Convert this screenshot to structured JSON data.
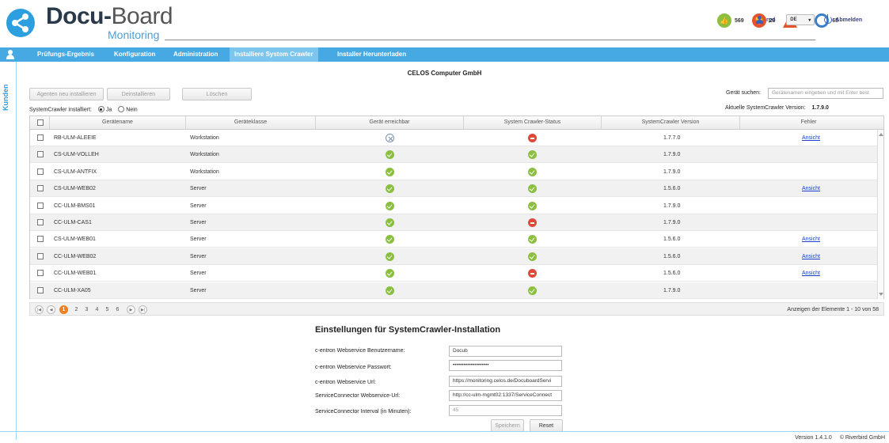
{
  "header": {
    "logo_bold": "Docu-",
    "logo_light": "Board",
    "logo_sub": "Monitoring",
    "stats": [
      {
        "icon": "thumbs-up-icon",
        "value": "569",
        "color": "#8bbf3f"
      },
      {
        "icon": "thumbs-down-icon",
        "value": "29",
        "color": "#e4532b"
      },
      {
        "icon": "warning-icon",
        "value": "17",
        "color": "#e4532b"
      },
      {
        "icon": "clock-icon",
        "value": "65",
        "color": "#3a7fc8"
      }
    ],
    "user": "rpd",
    "language": "DE",
    "logout": "Abmelden"
  },
  "nav": {
    "items": [
      "Prüfungs-Ergebnis",
      "Konfiguration",
      "Administration",
      "Installiere System Crawler",
      "Installer Herunterladen"
    ],
    "active": "Installiere System Crawler",
    "side_tab": "Kunden"
  },
  "company": "CELOS Computer GmbH",
  "toolbar": {
    "buttons": [
      "Agenten neu installieren",
      "Deinstallieren",
      "Löschen"
    ],
    "installed_label": "SystemCrawler installiert:",
    "radio_yes": "Ja",
    "radio_no": "Nein",
    "search_label": "Gerät suchen:",
    "search_placeholder": "Gerätenamen eingeben und mit Enter best",
    "version_label": "Aktuelle SystemCrawler Version:",
    "version_value": "1.7.9.0"
  },
  "table": {
    "headers": [
      "Gerätename",
      "Geräteklasse",
      "Gerät erreichbar",
      "System Crawler-Status",
      "SystemCrawler Version",
      "Fehler"
    ],
    "rows": [
      {
        "name": "RB-ULM-ALEEIE",
        "class": "Workstation",
        "reachable": "unreachable",
        "status": "error",
        "version": "1.7.7.0",
        "error": "Ansicht"
      },
      {
        "name": "CS-ULM-VOLLEH",
        "class": "Workstation",
        "reachable": "ok",
        "status": "ok",
        "version": "1.7.9.0",
        "error": ""
      },
      {
        "name": "CS-ULM-ANTFIX",
        "class": "Workstation",
        "reachable": "ok",
        "status": "ok",
        "version": "1.7.9.0",
        "error": ""
      },
      {
        "name": "CS-ULM-WEB02",
        "class": "Server",
        "reachable": "ok",
        "status": "ok",
        "version": "1.5.6.0",
        "error": "Ansicht"
      },
      {
        "name": "CC-ULM-BMS01",
        "class": "Server",
        "reachable": "ok",
        "status": "ok",
        "version": "1.7.9.0",
        "error": ""
      },
      {
        "name": "CC-ULM-CAS1",
        "class": "Server",
        "reachable": "ok",
        "status": "error",
        "version": "1.7.9.0",
        "error": ""
      },
      {
        "name": "CS-ULM-WEB01",
        "class": "Server",
        "reachable": "ok",
        "status": "ok",
        "version": "1.5.6.0",
        "error": "Ansicht"
      },
      {
        "name": "CC-ULM-WEB02",
        "class": "Server",
        "reachable": "ok",
        "status": "ok",
        "version": "1.5.6.0",
        "error": "Ansicht"
      },
      {
        "name": "CC-ULM-WEB01",
        "class": "Server",
        "reachable": "ok",
        "status": "error",
        "version": "1.5.6.0",
        "error": "Ansicht"
      },
      {
        "name": "CC-ULM-XA05",
        "class": "Server",
        "reachable": "ok",
        "status": "ok",
        "version": "1.7.9.0",
        "error": ""
      }
    ]
  },
  "pager": {
    "pages": [
      "1",
      "2",
      "3",
      "4",
      "5",
      "6"
    ],
    "current": "1",
    "info": "Anzeigen der Elemente 1 - 10 von 58"
  },
  "settings": {
    "title": "Einstellungen für SystemCrawler-Installation",
    "fields": [
      {
        "label": "c-entron Webservice Benutzername:",
        "value": "Docub",
        "disabled": false
      },
      {
        "label": "c-entron Webservice Passwort:",
        "value": "••••••••••••••••••••",
        "disabled": false
      },
      {
        "label": "c-entron Webservice Url:",
        "value": "https://monitoring.celos.de/DocuboardServi",
        "disabled": false
      },
      {
        "label": "ServiceConnector Webservice-Url:",
        "value": "http://cc-ulm-mgmt02:1337/ServiceConnect",
        "disabled": false
      },
      {
        "label": "ServiceConnector Interval (in Minuten):",
        "value": "45",
        "disabled": true
      }
    ],
    "save": "Speichern",
    "reset": "Reset"
  },
  "footer": {
    "version": "Version 1.4.1.0",
    "copyright": "© Riverbird GmbH"
  },
  "colors": {
    "accent": "#47a9e3",
    "ok": "#8bbf3f",
    "error": "#e0483a",
    "pager_current": "#f07f1d"
  }
}
